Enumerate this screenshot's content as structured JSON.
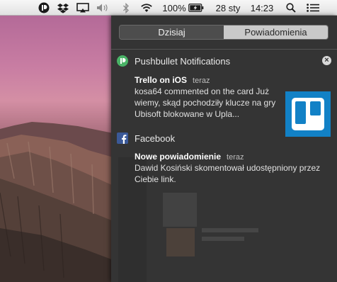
{
  "menubar": {
    "battery_percent": "100%",
    "date": "28 sty",
    "time": "14:23",
    "icons": [
      "pushbullet-icon",
      "dropbox-icon",
      "airplay-icon",
      "volume-icon",
      "bluetooth-icon",
      "wifi-icon",
      "battery-charging-icon",
      "spotlight-search-icon",
      "notification-center-icon"
    ]
  },
  "notification_center": {
    "tabs": [
      {
        "label": "Dzisiaj",
        "selected": false
      },
      {
        "label": "Powiadomienia",
        "selected": true
      }
    ],
    "groups": [
      {
        "app": "Pushbullet Notifications",
        "icon": "pushbullet-icon",
        "notifications": [
          {
            "title": "Trello on iOS",
            "time": "teraz",
            "body": "kosa64 commented on the card Już wiemy, skąd pochodziły klucze na gry Ubisoft blokowane w Upla...",
            "thumbnail": "trello-logo"
          }
        ]
      },
      {
        "app": "Facebook",
        "icon": "facebook-icon",
        "notifications": [
          {
            "title": "Nowe powiadomienie",
            "time": "teraz",
            "body": "Dawid Kosiński skomentował udostępniony przez Ciebie link."
          }
        ]
      }
    ]
  },
  "colors": {
    "panel_bg": "#343434",
    "trello_blue": "#1281c6",
    "facebook_blue": "#3b5998",
    "pushbullet_green": "#4ab367"
  }
}
